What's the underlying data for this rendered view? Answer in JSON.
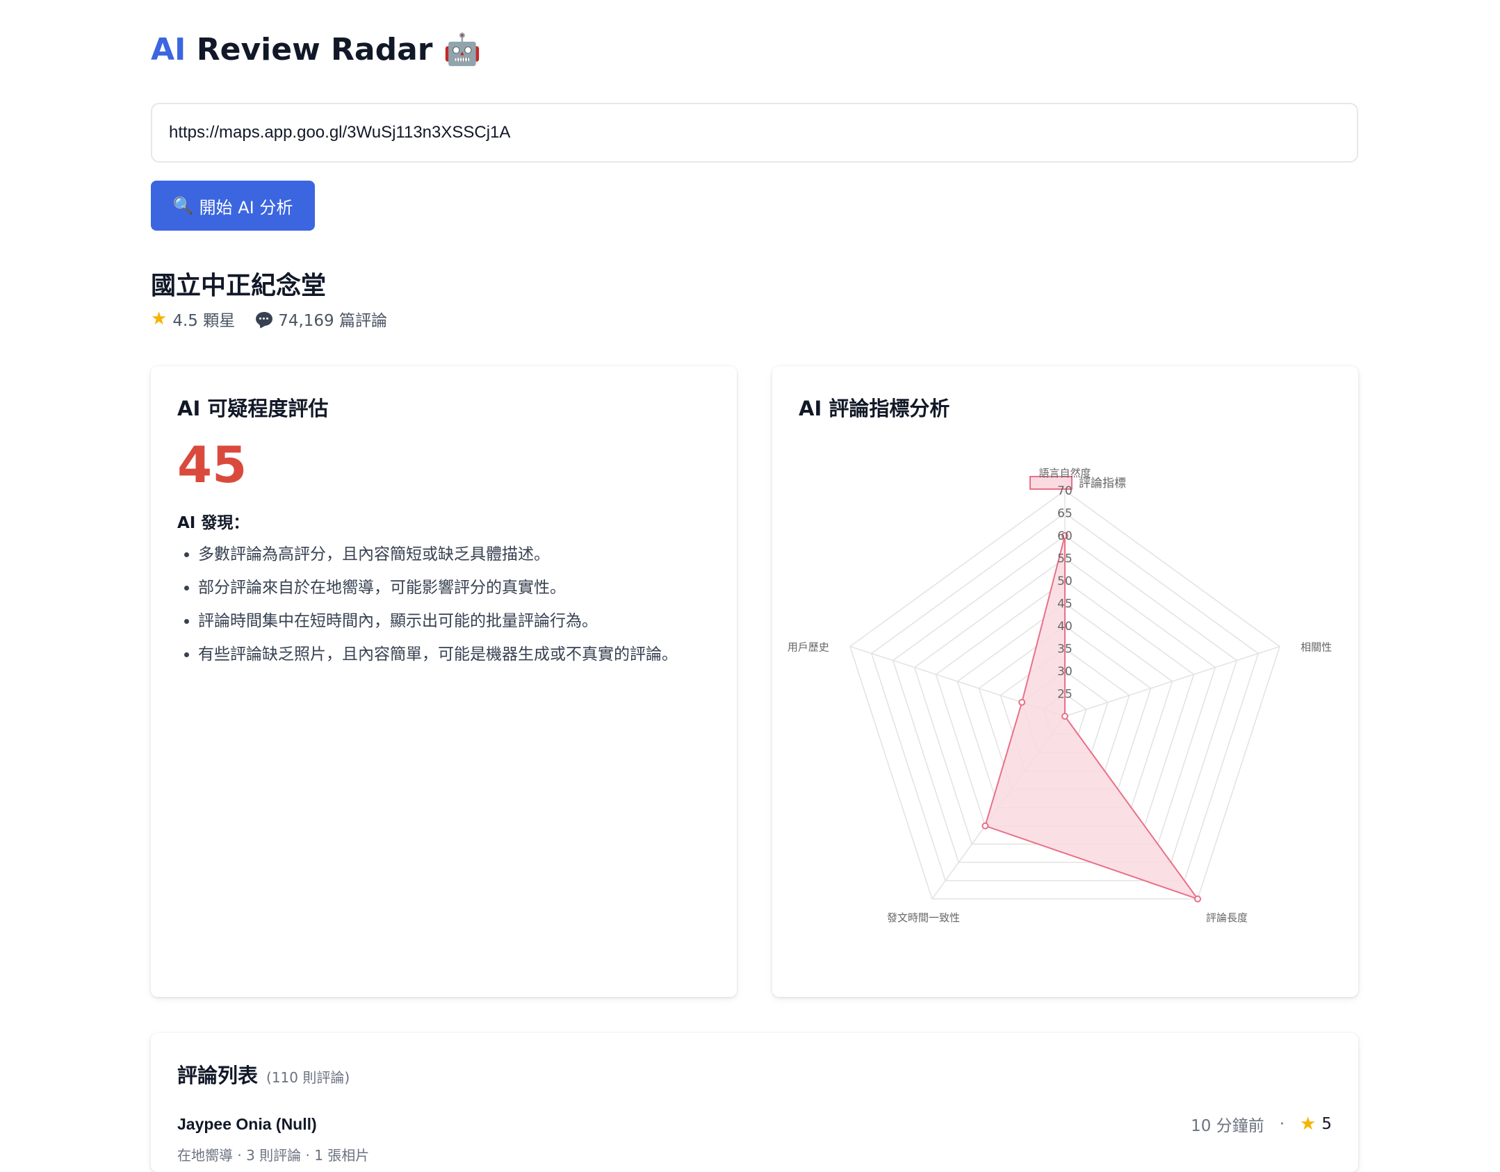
{
  "header": {
    "title_accent": "AI",
    "title_rest": " Review Radar ",
    "title_emoji": "🤖"
  },
  "search": {
    "url_value": "https://maps.app.goo.gl/3WuSj113n3XSSCj1A",
    "button_icon": "🔍",
    "button_label": "開始 AI 分析"
  },
  "place": {
    "name": "國立中正紀念堂",
    "rating_text": "4.5 顆星",
    "reviews_text": "74,169 篇評論"
  },
  "suspicion": {
    "title": "AI 可疑程度評估",
    "score": "45",
    "findings_label": "AI 發現：",
    "findings": [
      "多數評論為高評分，且內容簡短或缺乏具體描述。",
      "部分評論來自於在地嚮導，可能影響評分的真實性。",
      "評論時間集中在短時間內，顯示出可能的批量評論行為。",
      "有些評論缺乏照片，且內容簡單，可能是機器生成或不真實的評論。"
    ]
  },
  "metrics": {
    "title": "AI 評論指標分析"
  },
  "chart_data": {
    "type": "radar",
    "categories": [
      "語言自然度",
      "相關性",
      "評論長度",
      "發文時間一致性",
      "用戶歷史"
    ],
    "series": [
      {
        "name": "評論指標",
        "values": [
          60,
          20,
          70,
          50,
          30
        ]
      }
    ],
    "rlim": [
      20,
      70
    ],
    "ticks": [
      25,
      30,
      35,
      40,
      45,
      50,
      55,
      60,
      65,
      70
    ],
    "legend": "top",
    "colors": {
      "line": "#ea6f86",
      "fill": "#f9dbe1",
      "grid": "#e2e2e2"
    }
  },
  "reviews": {
    "title": "評論列表",
    "count_text": "(110 則評論)",
    "items": [
      {
        "author": "Jaypee Onia (Null)",
        "time": "10 分鐘前",
        "rating": "5",
        "meta": "在地嚮導 · 3 則評論 · 1 張相片"
      }
    ]
  }
}
